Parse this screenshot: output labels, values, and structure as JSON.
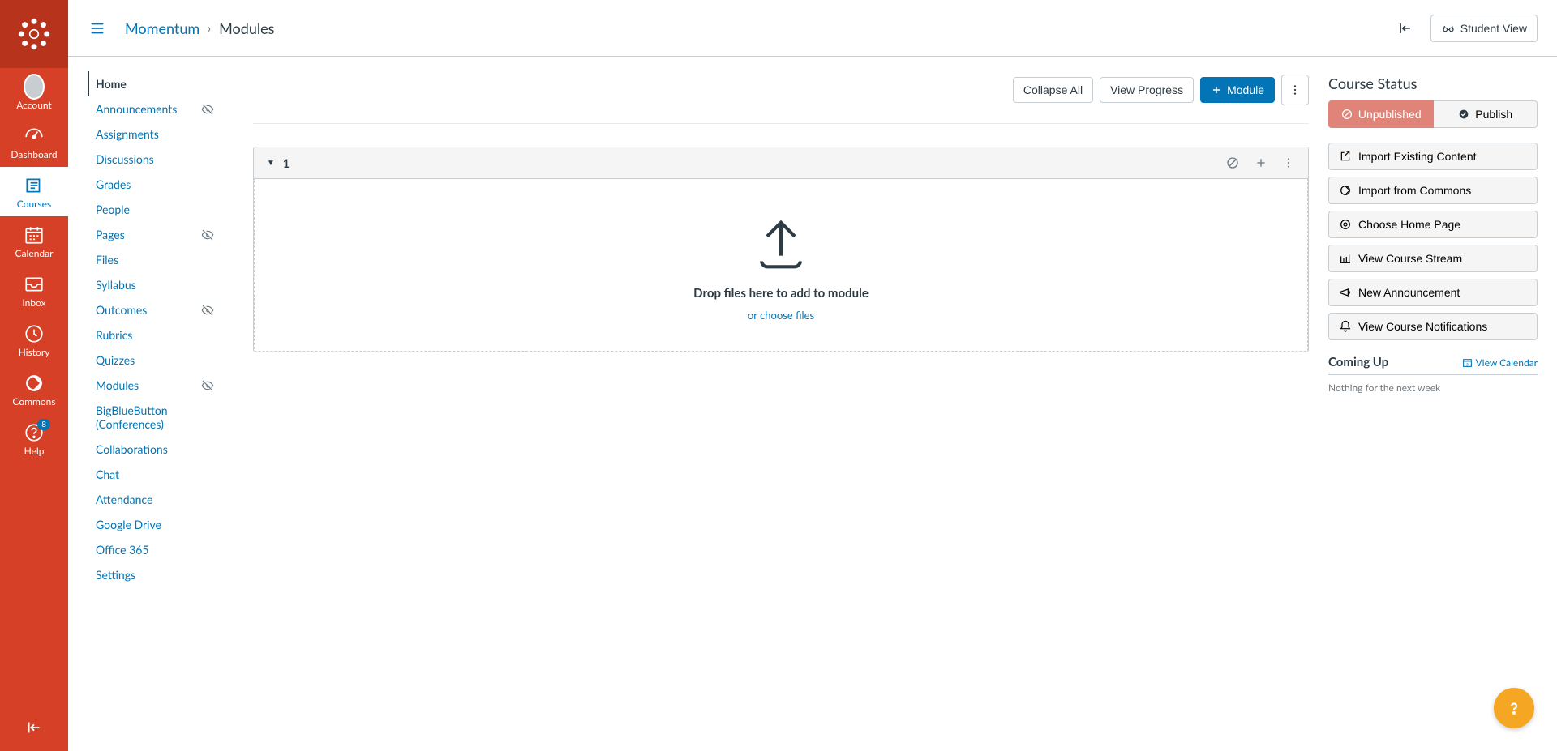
{
  "globalNav": {
    "items": [
      {
        "key": "account",
        "label": "Account"
      },
      {
        "key": "dashboard",
        "label": "Dashboard"
      },
      {
        "key": "courses",
        "label": "Courses"
      },
      {
        "key": "calendar",
        "label": "Calendar"
      },
      {
        "key": "inbox",
        "label": "Inbox"
      },
      {
        "key": "history",
        "label": "History"
      },
      {
        "key": "commons",
        "label": "Commons"
      },
      {
        "key": "help",
        "label": "Help",
        "badge": "8"
      }
    ]
  },
  "breadcrumbs": {
    "course": "Momentum",
    "page": "Modules"
  },
  "topbar": {
    "studentView": "Student View"
  },
  "courseNav": {
    "items": [
      {
        "label": "Home",
        "active": true
      },
      {
        "label": "Announcements",
        "hidden": true
      },
      {
        "label": "Assignments"
      },
      {
        "label": "Discussions"
      },
      {
        "label": "Grades"
      },
      {
        "label": "People"
      },
      {
        "label": "Pages",
        "hidden": true
      },
      {
        "label": "Files"
      },
      {
        "label": "Syllabus"
      },
      {
        "label": "Outcomes",
        "hidden": true
      },
      {
        "label": "Rubrics"
      },
      {
        "label": "Quizzes"
      },
      {
        "label": "Modules",
        "hidden": true
      },
      {
        "label": "BigBlueButton (Conferences)"
      },
      {
        "label": "Collaborations"
      },
      {
        "label": "Chat"
      },
      {
        "label": "Attendance"
      },
      {
        "label": "Google Drive"
      },
      {
        "label": "Office 365"
      },
      {
        "label": "Settings"
      }
    ]
  },
  "pageActions": {
    "collapseAll": "Collapse All",
    "viewProgress": "View Progress",
    "addModule": "Module"
  },
  "module": {
    "title": "1",
    "dropzone": {
      "title": "Drop files here to add to module",
      "link": "or choose files"
    }
  },
  "rightRail": {
    "statusHeading": "Course Status",
    "unpublished": "Unpublished",
    "publish": "Publish",
    "buttons": [
      "Import Existing Content",
      "Import from Commons",
      "Choose Home Page",
      "View Course Stream",
      "New Announcement",
      "View Course Notifications"
    ],
    "comingUp": "Coming Up",
    "viewCalendar": "View Calendar",
    "nothing": "Nothing for the next week"
  }
}
